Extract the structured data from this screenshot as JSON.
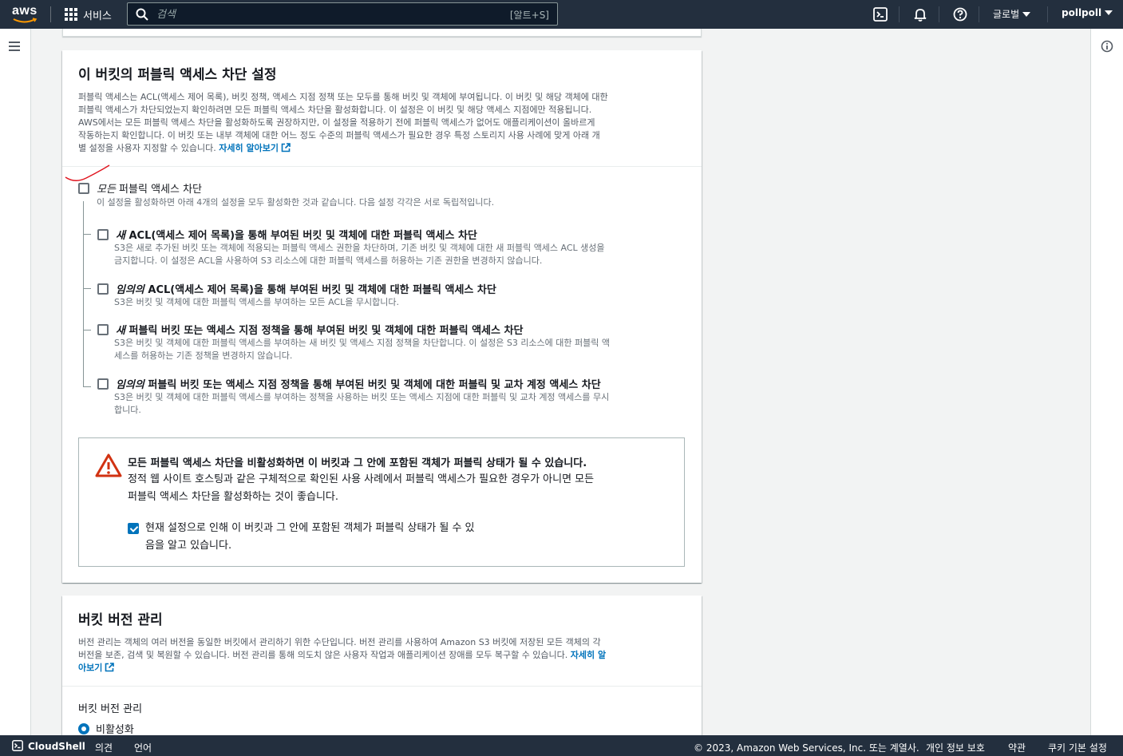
{
  "topnav": {
    "logo_text": "aws",
    "services_label": "서비스",
    "search_placeholder": "검색",
    "search_shortcut": "[알트+S]",
    "region_label": "글로벌",
    "user_label": "pollpoll",
    "icons": [
      "cloudshell-icon",
      "bell-icon",
      "help-icon"
    ]
  },
  "block_public_access": {
    "title": "이 버킷의 퍼블릭 액세스 차단 설정",
    "desc_line1": "퍼블릭 액세스는 ACL(액세스 제어 목록), 버킷 정책, 액세스 지점 정책 또는 모두를 통해 버킷 및 객체에 부여됩니다. 이 버킷 및 해당 객체에 대한",
    "desc_line2": "퍼블릭 액세스가 차단되었는지 확인하려면 모든 퍼블릭 액세스 차단을 활성화합니다. 이 설정은 이 버킷 및 해당 액세스 지점에만 적용됩니다.",
    "desc_line3": "AWS에서는 모든 퍼블릭 액세스 차단을 활성화하도록 권장하지만, 이 설정을 적용하기 전에 퍼블릭 액세스가 없어도 애플리케이션이 올바르게",
    "desc_line4": "작동하는지 확인합니다. 이 버킷 또는 내부 객체에 대한 어느 정도 수준의 퍼블릭 액세스가 필요한 경우 특정 스토리지 사용 사례에 맞게 아래 개",
    "desc_line5": "별 설정을 사용자 지정할 수 있습니다.",
    "learn_more": "자세히 알아보기",
    "all": {
      "title_em": "모든",
      "title_rest": " 퍼블릭 액세스 차단",
      "desc": "이 설정을 활성화하면 아래 4개의 설정을 모두 활성화한 것과 같습니다. 다음 설정 각각은 서로 독립적입니다.",
      "checked": false
    },
    "options": [
      {
        "title_em": "새",
        "title_rest": " ACL(액세스 제어 목록)을 통해 부여된 버킷 및 객체에 대한 퍼블릭 액세스 차단",
        "desc1": "S3은 새로 추가된 버킷 또는 객체에 적용되는 퍼블릭 액세스 권한을 차단하며, 기존 버킷 및 객체에 대한 새 퍼블릭 액세스 ACL 생성을",
        "desc2": "금지합니다. 이 설정은 ACL을 사용하여 S3 리소스에 대한 퍼블릭 액세스를 허용하는 기존 권한을 변경하지 않습니다.",
        "checked": false
      },
      {
        "title_em": "임의의",
        "title_rest": " ACL(액세스 제어 목록)을 통해 부여된 버킷 및 객체에 대한 퍼블릭 액세스 차단",
        "desc1": "S3은 버킷 및 객체에 대한 퍼블릭 액세스를 부여하는 모든 ACL을 무시합니다.",
        "desc2": "",
        "checked": false
      },
      {
        "title_em": "새",
        "title_rest": " 퍼블릭 버킷 또는 액세스 지점 정책을 통해 부여된 버킷 및 객체에 대한 퍼블릭 액세스 차단",
        "desc1": "S3은 버킷 및 객체에 대한 퍼블릭 액세스를 부여하는 새 버킷 및 액세스 지점 정책을 차단합니다. 이 설정은 S3 리소스에 대한 퍼블릭 액",
        "desc2": "세스를 허용하는 기존 정책을 변경하지 않습니다.",
        "checked": false
      },
      {
        "title_em": "임의의",
        "title_rest": " 퍼블릭 버킷 또는 액세스 지점 정책을 통해 부여된 버킷 및 객체에 대한 퍼블릭 및 교차 계정 액세스 차단",
        "desc1": "S3은 버킷 및 객체에 대한 퍼블릭 액세스를 부여하는 정책을 사용하는 버킷 또는 액세스 지점에 대한 퍼블릭 및 교차 계정 액세스를 무시",
        "desc2": "합니다.",
        "checked": false
      }
    ],
    "warning": {
      "title": "모든 퍼블릭 액세스 차단을 비활성화하면 이 버킷과 그 안에 포함된 객체가 퍼블릭 상태가 될 수 있습니다.",
      "text1": "정적 웹 사이트 호스팅과 같은 구체적으로 확인된 사용 사례에서 퍼블릭 액세스가 필요한 경우가 아니면 모든",
      "text2": "퍼블릭 액세스 차단을 활성화하는 것이 좋습니다.",
      "ack1": "현재 설정으로 인해 이 버킷과 그 안에 포함된 객체가 퍼블릭 상태가 될 수 있",
      "ack2": "음을 알고 있습니다.",
      "ack_checked": true
    }
  },
  "versioning": {
    "title": "버킷 버전 관리",
    "desc_line1": "버전 관리는 객체의 여러 버전을 동일한 버킷에서 관리하기 위한 수단입니다. 버전 관리를 사용하여 Amazon S3 버킷에 저장된 모든 객체의 각",
    "desc_line2": "버전을 보존, 검색 및 복원할 수 있습니다. 버전 관리를 통해 의도치 않은 사용자 작업과 애플리케이션 장애를 모두 복구할 수 있습니다.",
    "learn_more_a": "자세히 알",
    "learn_more_b": "아보기",
    "field_label": "버킷 버전 관리",
    "selected_option": "비활성화"
  },
  "footer": {
    "cloudshell": "CloudShell",
    "feedback": "의견",
    "language": "언어",
    "copyright": "© 2023, Amazon Web Services, Inc. 또는 계열사.",
    "privacy": "개인 정보 보호",
    "terms": "약관",
    "cookies": "쿠키 기본 설정"
  },
  "colors": {
    "nav_bg": "#232f3e",
    "link": "#0073bb",
    "warning_red": "#d13212",
    "annotation_red": "#e0141e"
  }
}
